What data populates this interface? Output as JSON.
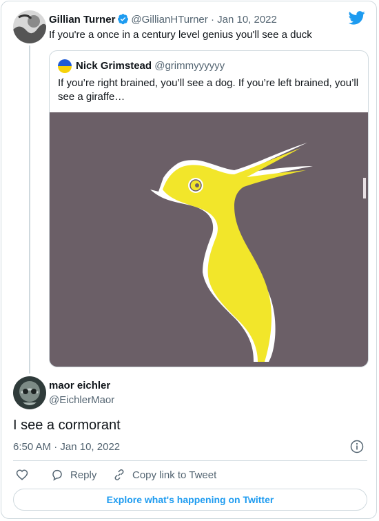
{
  "colors": {
    "accent": "#1d9bf0",
    "text": "#0f1419",
    "muted": "#536471",
    "border": "#cfd9de",
    "media_bg": "#6b5f67",
    "duck_yellow": "#f2e62a"
  },
  "parent_tweet": {
    "name": "Gillian Turner",
    "handle": "@GillianHTurner",
    "separator": "·",
    "date": "Jan 10, 2022",
    "text": "If you're a once in a century level genius you'll see a duck",
    "avatar_icon": "avatar-photo",
    "verified_icon": "verified-badge-icon"
  },
  "quoted_tweet": {
    "name": "Nick Grimstead",
    "handle": "@grimmyyyyyy",
    "text": "If you’re right brained, you’ll see a dog. If you’re left brained, you’ll see a giraffe…",
    "avatar_icon": "ukraine-flag-avatar",
    "media_icon": "yellow-bird-illusion-image"
  },
  "reply_tweet": {
    "name": "maor eichler",
    "handle": "@EichlerMaor",
    "text": "I see a cormorant",
    "time": "6:50 AM",
    "separator": "·",
    "date": "Jan 10, 2022",
    "avatar_icon": "avatar-photo"
  },
  "actions": {
    "like_icon": "heart-icon",
    "reply_label": "Reply",
    "reply_icon": "comment-icon",
    "copy_label": "Copy link to Tweet",
    "copy_icon": "link-icon"
  },
  "explore_label": "Explore what's happening on Twitter",
  "logo_icon": "twitter-bird-icon"
}
